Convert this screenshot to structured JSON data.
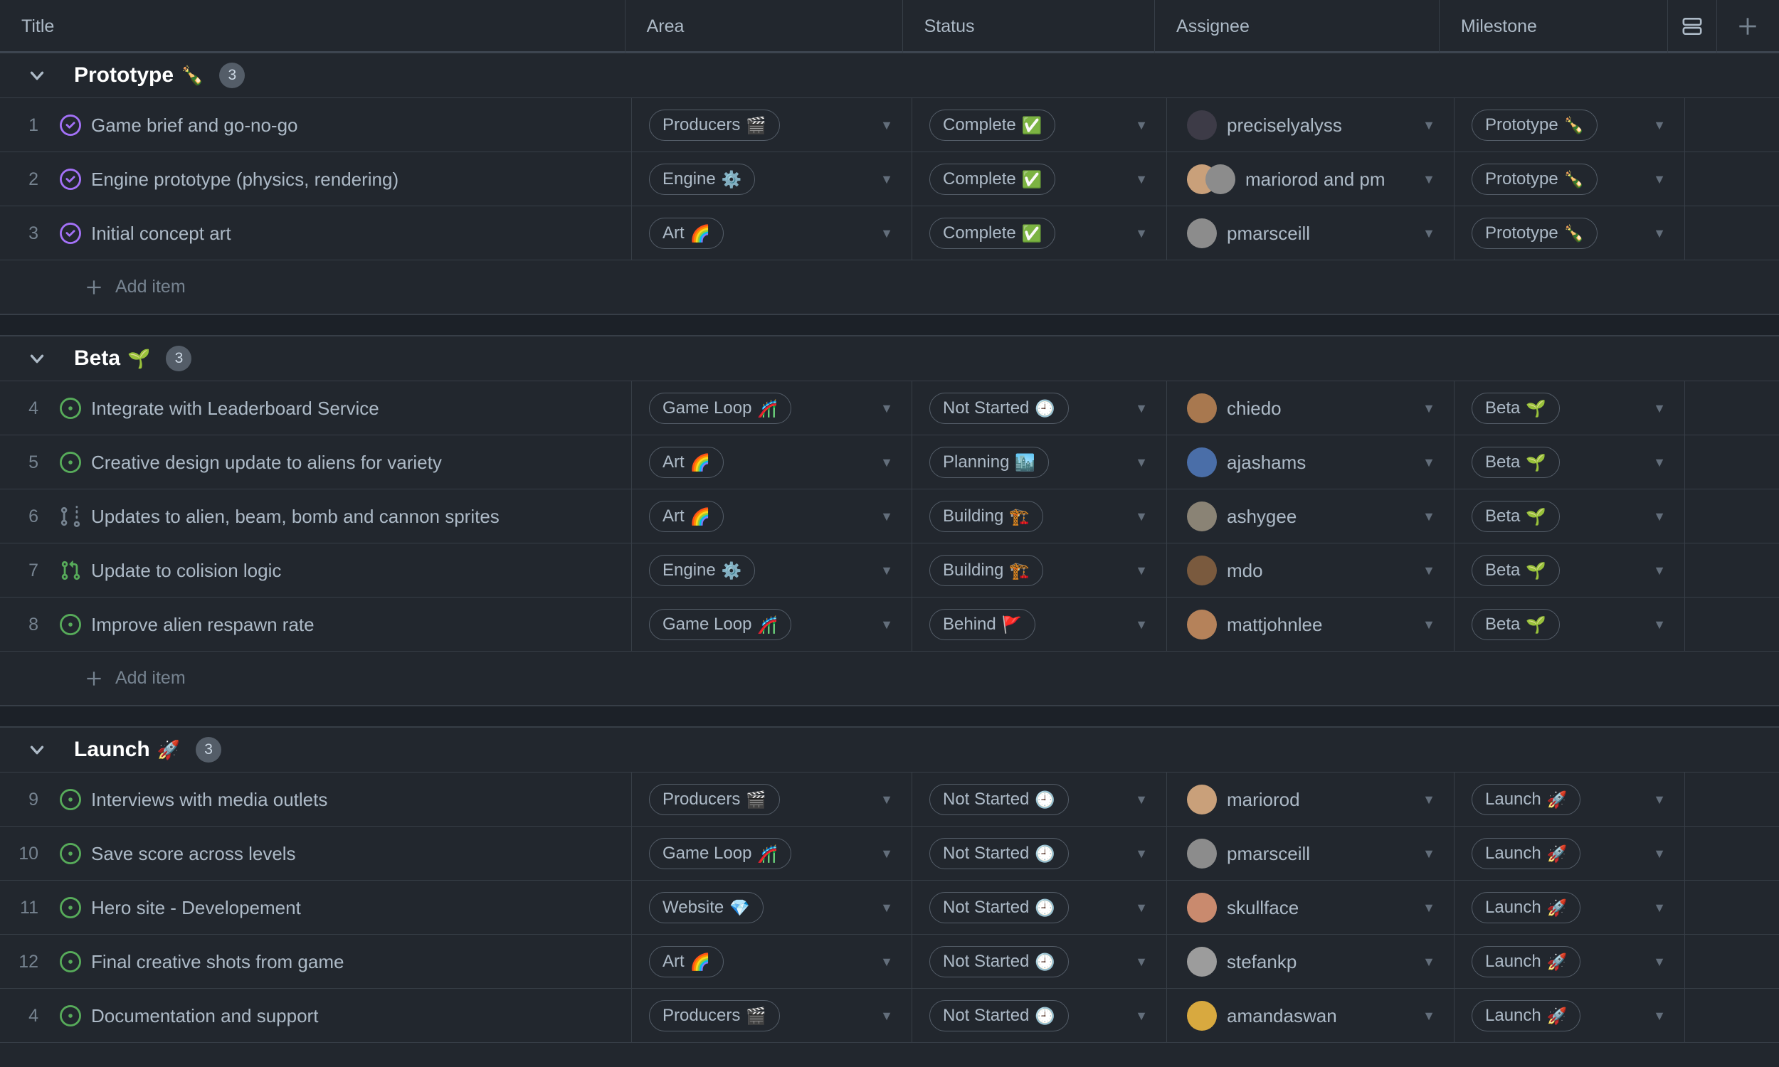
{
  "header": {
    "columns": [
      {
        "label": "Title",
        "name": "title"
      },
      {
        "label": "Area",
        "name": "area"
      },
      {
        "label": "Status",
        "name": "status"
      },
      {
        "label": "Assignee",
        "name": "assignee"
      },
      {
        "label": "Milestone",
        "name": "milestone"
      }
    ],
    "layout_toggle_icon": "rows-layout-icon",
    "add_column_label": "+"
  },
  "colors": {
    "background": "#22272e",
    "row_border": "#373e47",
    "section_gap": "#1c2128",
    "text": "#adbac7",
    "text_muted": "#768390",
    "chip_border": "#545d68",
    "closed_issue": "#a371f7",
    "open_issue": "#57ab5a",
    "open_pr": "#57ab5a",
    "draft_pr": "#768390",
    "badge_bg": "#545d68"
  },
  "add_item_label": "Add item",
  "groups": [
    {
      "name": "Prototype",
      "emoji": "🍾",
      "count": "3",
      "collapsed": false,
      "rows": [
        {
          "num": "1",
          "icon": "closed-issue-icon",
          "title": "Game brief and go-no-go",
          "area": "Producers",
          "area_emoji": "🎬",
          "status": "Complete",
          "status_emoji": "✅",
          "assignee": "preciselyalyss",
          "avatars": [
            "#3d3b47"
          ],
          "milestone": "Prototype",
          "milestone_emoji": "🍾"
        },
        {
          "num": "2",
          "icon": "closed-issue-icon",
          "title": "Engine prototype (physics, rendering)",
          "area": "Engine",
          "area_emoji": "⚙️",
          "status": "Complete",
          "status_emoji": "✅",
          "assignee": "mariorod and pm",
          "avatars": [
            "#c9a07a",
            "#8c8c8c"
          ],
          "milestone": "Prototype",
          "milestone_emoji": "🍾"
        },
        {
          "num": "3",
          "icon": "closed-issue-icon",
          "title": "Initial concept art",
          "area": "Art",
          "area_emoji": "🌈",
          "status": "Complete",
          "status_emoji": "✅",
          "assignee": "pmarsceill",
          "avatars": [
            "#8c8c8c"
          ],
          "milestone": "Prototype",
          "milestone_emoji": "🍾"
        }
      ]
    },
    {
      "name": "Beta",
      "emoji": "🌱",
      "count": "3",
      "collapsed": false,
      "rows": [
        {
          "num": "4",
          "icon": "open-issue-icon",
          "title": "Integrate with Leaderboard Service",
          "area": "Game Loop",
          "area_emoji": "🎢",
          "status": "Not Started",
          "status_emoji": "🕘",
          "assignee": "chiedo",
          "avatars": [
            "#a8784f"
          ],
          "milestone": "Beta",
          "milestone_emoji": "🌱"
        },
        {
          "num": "5",
          "icon": "open-issue-icon",
          "title": "Creative design update to aliens for variety",
          "area": "Art",
          "area_emoji": "🌈",
          "status": "Planning",
          "status_emoji": "🏙️",
          "assignee": "ajashams",
          "avatars": [
            "#4a6ea8"
          ],
          "milestone": "Beta",
          "milestone_emoji": "🌱"
        },
        {
          "num": "6",
          "icon": "draft-pr-icon",
          "title": "Updates to alien, beam, bomb and cannon sprites",
          "area": "Art",
          "area_emoji": "🌈",
          "status": "Building",
          "status_emoji": "🏗️",
          "assignee": "ashygee",
          "avatars": [
            "#8a8375"
          ],
          "milestone": "Beta",
          "milestone_emoji": "🌱"
        },
        {
          "num": "7",
          "icon": "open-pr-icon",
          "title": "Update to colision logic",
          "area": "Engine",
          "area_emoji": "⚙️",
          "status": "Building",
          "status_emoji": "🏗️",
          "assignee": "mdo",
          "avatars": [
            "#7a5a3e"
          ],
          "milestone": "Beta",
          "milestone_emoji": "🌱"
        },
        {
          "num": "8",
          "icon": "open-issue-icon",
          "title": "Improve alien respawn rate",
          "area": "Game Loop",
          "area_emoji": "🎢",
          "status": "Behind",
          "status_emoji": "🚩",
          "assignee": "mattjohnlee",
          "avatars": [
            "#b5825a"
          ],
          "milestone": "Beta",
          "milestone_emoji": "🌱"
        }
      ]
    },
    {
      "name": "Launch",
      "emoji": "🚀",
      "count": "3",
      "collapsed": false,
      "rows": [
        {
          "num": "9",
          "icon": "open-issue-icon",
          "title": "Interviews with media outlets",
          "area": "Producers",
          "area_emoji": "🎬",
          "status": "Not Started",
          "status_emoji": "🕘",
          "assignee": "mariorod",
          "avatars": [
            "#c9a07a"
          ],
          "milestone": "Launch",
          "milestone_emoji": "🚀"
        },
        {
          "num": "10",
          "icon": "open-issue-icon",
          "title": "Save score across levels",
          "area": "Game Loop",
          "area_emoji": "🎢",
          "status": "Not Started",
          "status_emoji": "🕘",
          "assignee": "pmarsceill",
          "avatars": [
            "#8c8c8c"
          ],
          "milestone": "Launch",
          "milestone_emoji": "🚀"
        },
        {
          "num": "11",
          "icon": "open-issue-icon",
          "title": "Hero site - Developement",
          "area": "Website",
          "area_emoji": "💎",
          "status": "Not Started",
          "status_emoji": "🕘",
          "assignee": "skullface",
          "avatars": [
            "#c98a6e"
          ],
          "milestone": "Launch",
          "milestone_emoji": "🚀"
        },
        {
          "num": "12",
          "icon": "open-issue-icon",
          "title": "Final creative shots from game",
          "area": "Art",
          "area_emoji": "🌈",
          "status": "Not Started",
          "status_emoji": "🕘",
          "assignee": "stefankp",
          "avatars": [
            "#9c9c9c"
          ],
          "milestone": "Launch",
          "milestone_emoji": "🚀"
        },
        {
          "num": "4",
          "icon": "open-issue-icon",
          "title": "Documentation and support",
          "area": "Producers",
          "area_emoji": "🎬",
          "status": "Not Started",
          "status_emoji": "🕘",
          "assignee": "amandaswan",
          "avatars": [
            "#d8a93f"
          ],
          "milestone": "Launch",
          "milestone_emoji": "🚀"
        }
      ]
    }
  ]
}
